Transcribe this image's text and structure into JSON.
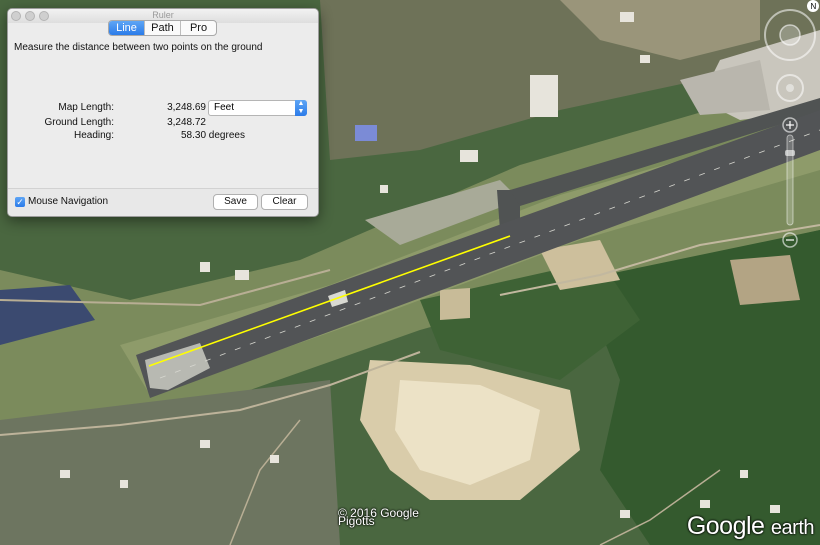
{
  "window": {
    "title": "Ruler"
  },
  "tabs": [
    {
      "label": "Line",
      "active": true
    },
    {
      "label": "Path",
      "active": false
    },
    {
      "label": "Pro",
      "active": false
    }
  ],
  "instruction": "Measure the distance between two points on the ground",
  "measurements": {
    "map_length_label": "Map Length:",
    "map_length_value": "3,248.69",
    "ground_length_label": "Ground Length:",
    "ground_length_value": "3,248.72",
    "heading_label": "Heading:",
    "heading_value": "58.30 degrees"
  },
  "unit_select": {
    "selected": "Feet"
  },
  "footer": {
    "mouse_navigation_label": "Mouse Navigation",
    "mouse_navigation_checked": true,
    "save_label": "Save",
    "clear_label": "Clear"
  },
  "map": {
    "copyright": "© 2016 Google",
    "place_label": "Pigotts",
    "brand_google": "Google",
    "brand_earth": "earth",
    "measure_line_color": "#ffff00"
  },
  "colors": {
    "accent": "#2b7be9"
  }
}
